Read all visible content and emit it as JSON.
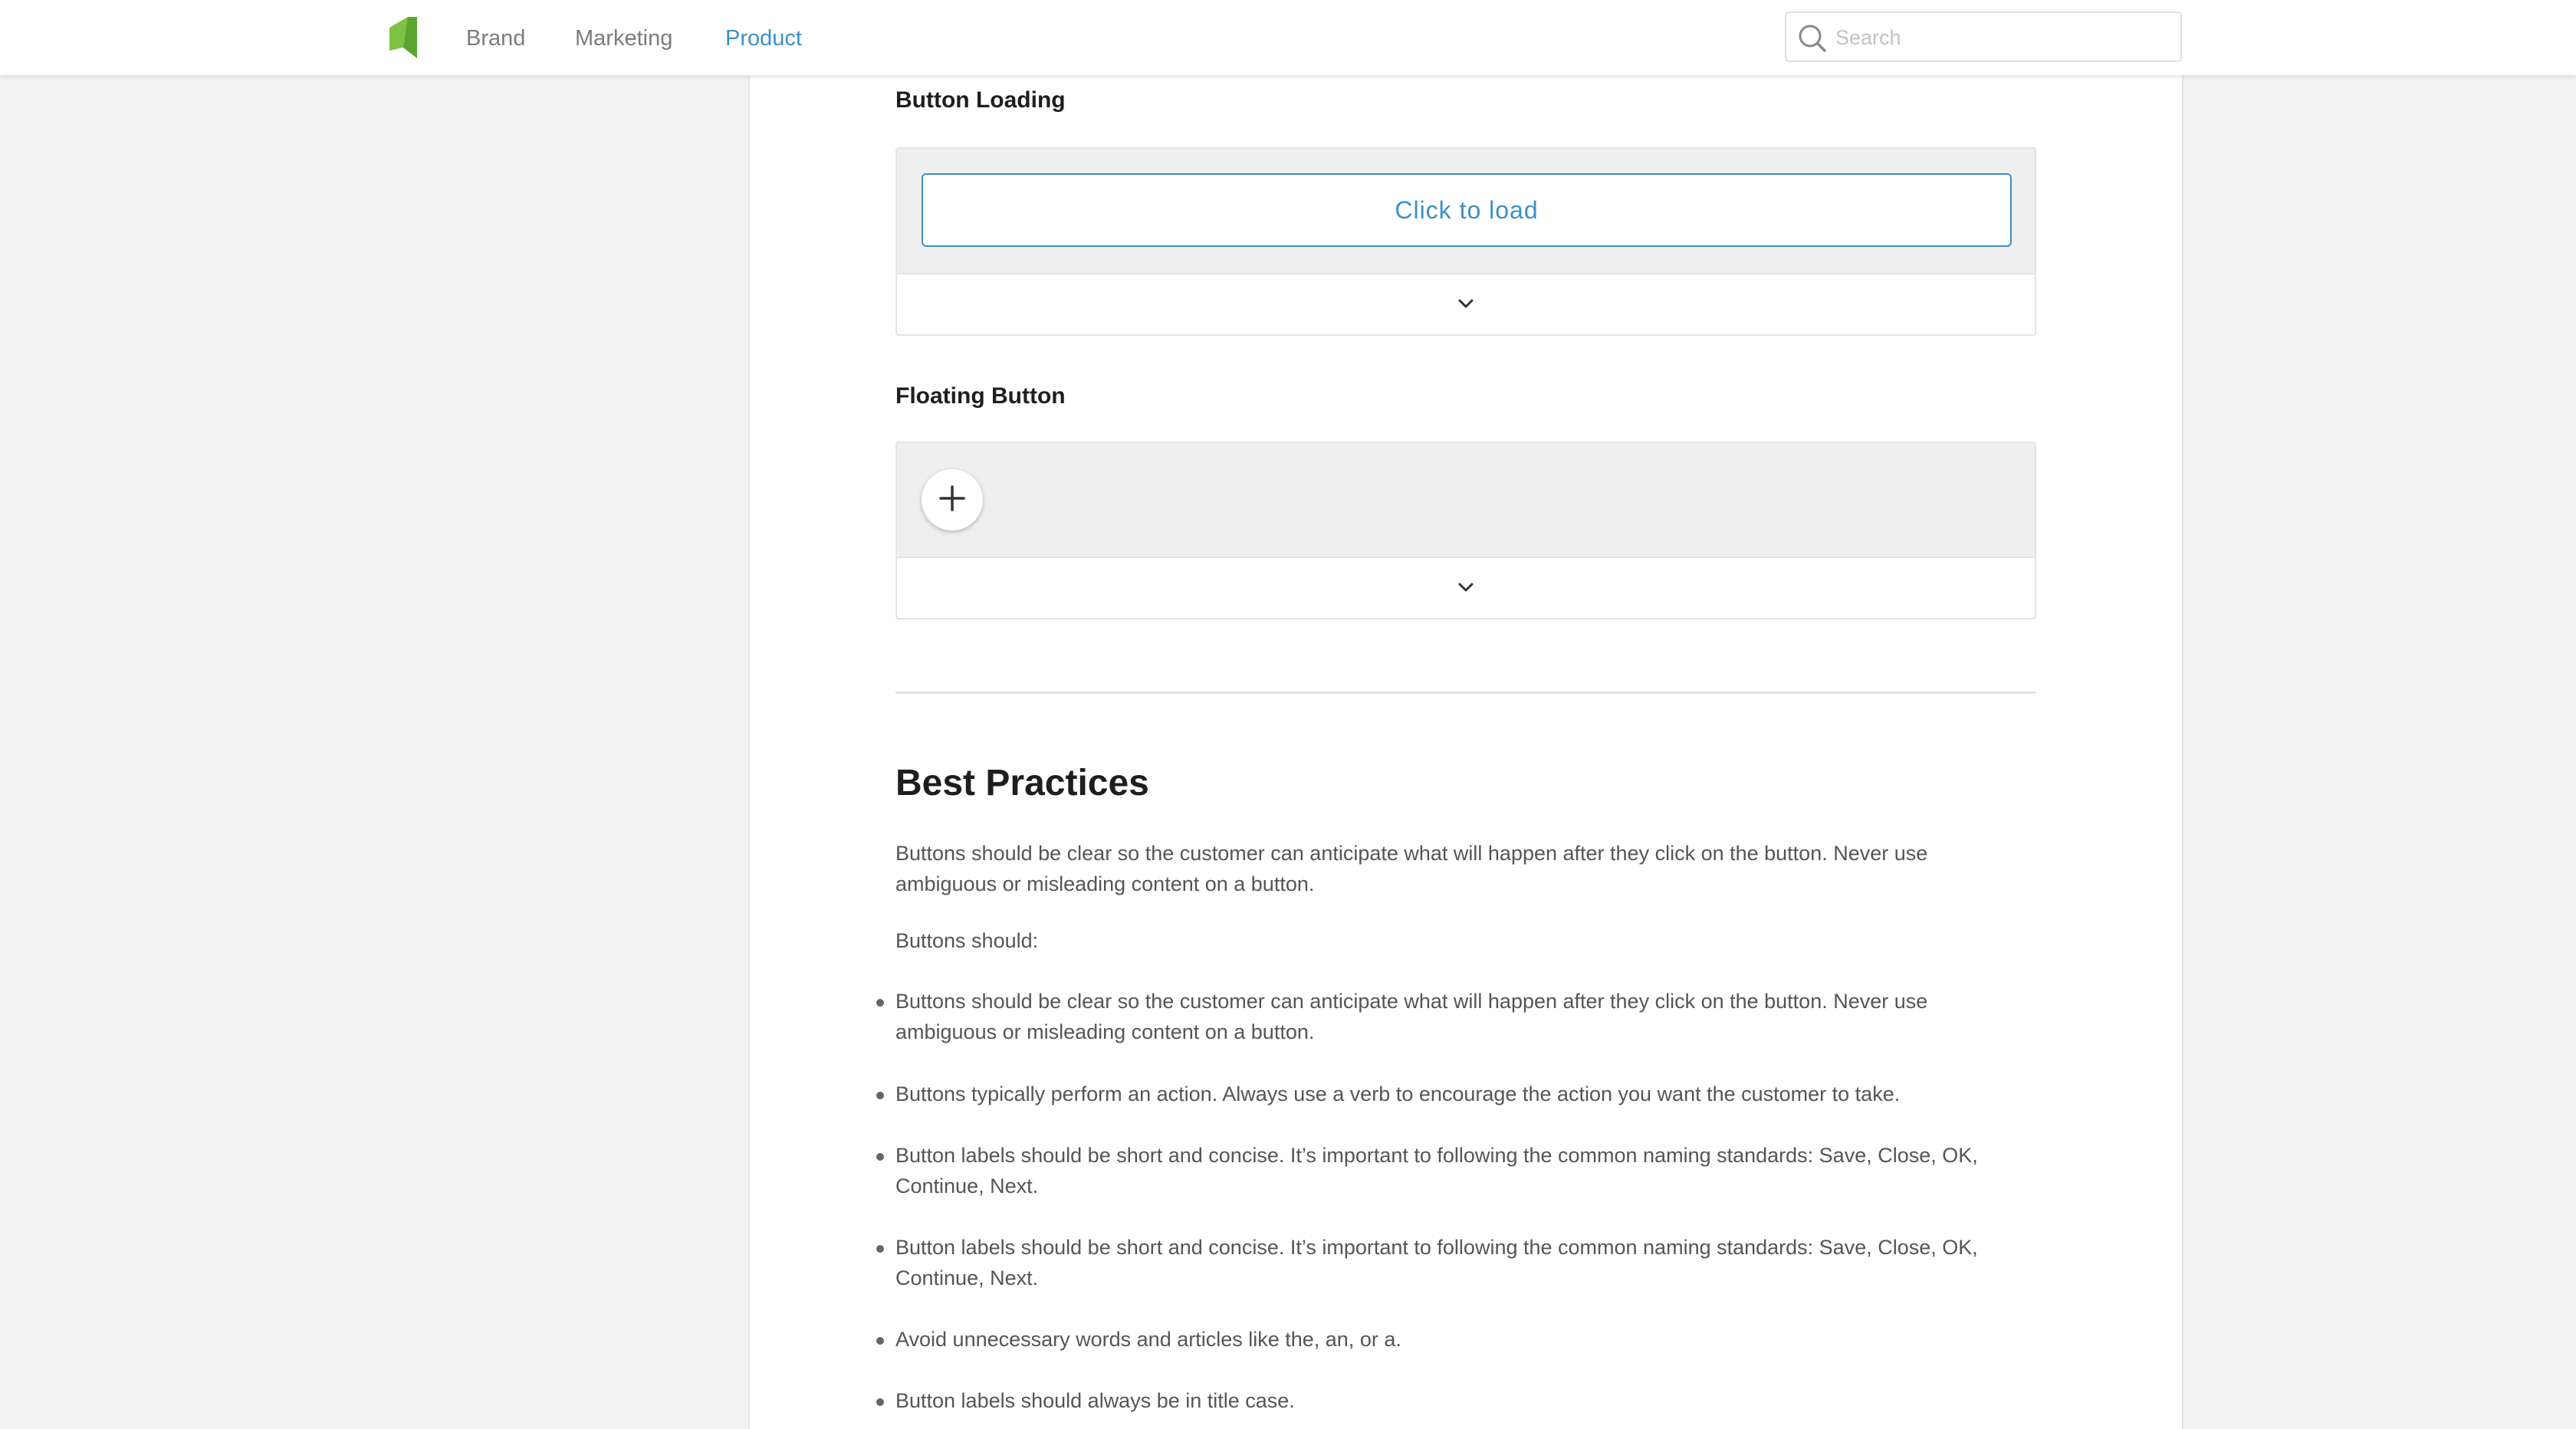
{
  "nav": {
    "links": [
      "Brand",
      "Marketing",
      "Product"
    ],
    "active": "Product",
    "search_placeholder": "Search"
  },
  "colors": {
    "accent": "#3d8fc6",
    "logo_green": "#7dc243",
    "preview_bg": "#efefef"
  },
  "icons": {
    "logo": "leaf-logo",
    "search": "search-icon",
    "expand": "chevron-down-icon",
    "fab": "plus-icon"
  },
  "sections": {
    "button_loading": {
      "title": "Button Loading",
      "button_label": "Click to load"
    },
    "floating_button": {
      "title": "Floating Button"
    }
  },
  "best_practices": {
    "title": "Best Practices",
    "intro": "Buttons should be clear so the customer can anticipate what will happen after they click on the button. Never use ambiguous or misleading content on a button.",
    "lead": "Buttons should:",
    "items": [
      "Buttons should be clear so the customer can anticipate what will happen after they click on the button. Never use ambiguous or misleading content on a button.",
      "Buttons typically perform an action. Always use a verb to encourage the action you want the customer to take.",
      "Button labels should be short and concise. It’s important to following the common naming standards: Save, Close, OK, Continue, Next.",
      "Button labels should be short and concise. It’s important to following the common naming standards: Save, Close, OK, Continue, Next.",
      "Avoid unnecessary words and articles like the, an, or a.",
      "Button labels should always be in title case."
    ]
  }
}
